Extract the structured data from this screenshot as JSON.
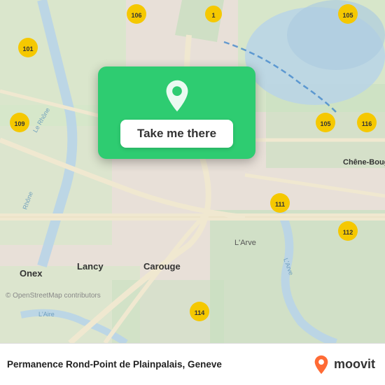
{
  "map": {
    "attribution": "© OpenStreetMap contributors",
    "background_color": "#e8f0e0"
  },
  "card": {
    "button_label": "Take me there",
    "pin_icon": "location-pin"
  },
  "bottom_bar": {
    "location_title": "Permanence Rond-Point de Plainpalais, Geneve",
    "logo_text": "moovit"
  }
}
